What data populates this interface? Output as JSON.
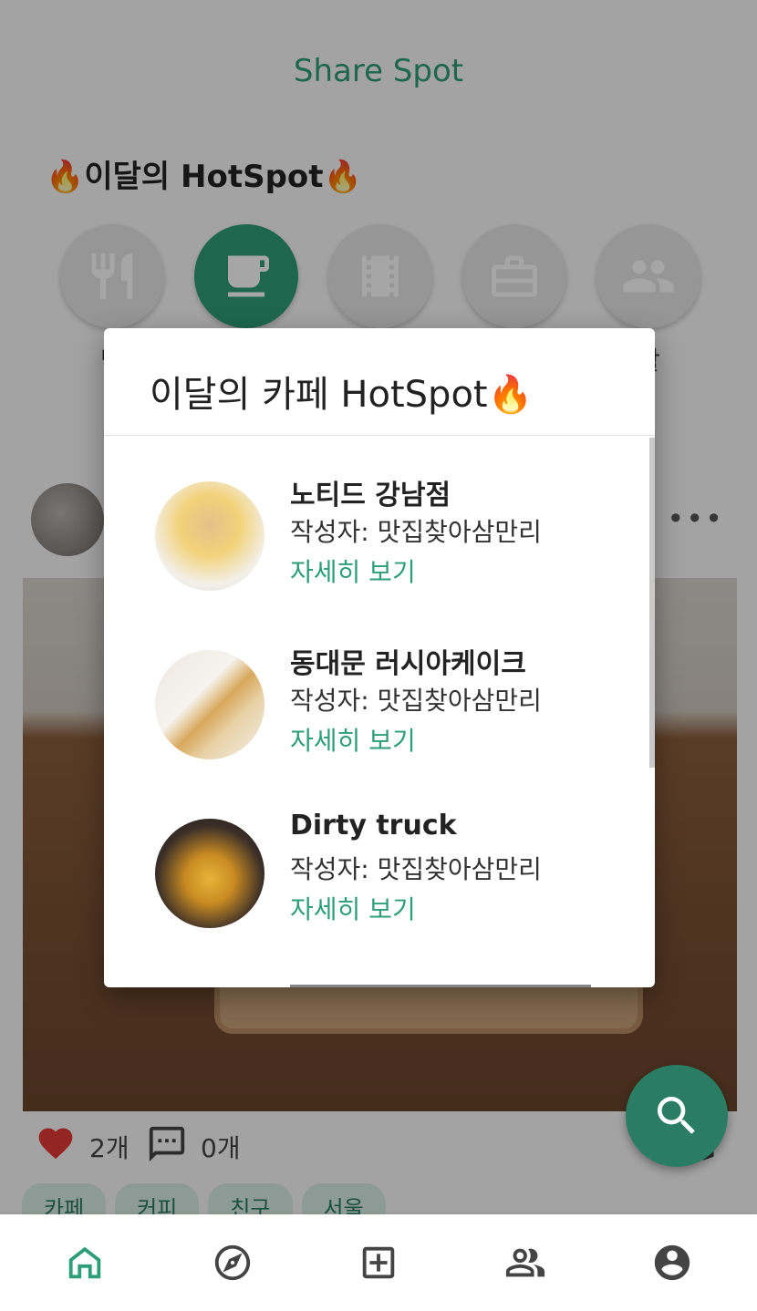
{
  "app": {
    "title": "Share Spot",
    "section_title": "🔥이달의 HotSpot🔥",
    "accent_color": "#2e9e78"
  },
  "categories": [
    {
      "icon": "fork-knife-icon",
      "label": "맛"
    },
    {
      "icon": "coffee-cup-icon",
      "label": "",
      "active": true
    },
    {
      "icon": "film-icon",
      "label": ""
    },
    {
      "icon": "briefcase-icon",
      "label": ""
    },
    {
      "icon": "people-icon",
      "label": "활"
    }
  ],
  "post": {
    "like_count": "2개",
    "comment_count": "0개",
    "more": "•••",
    "tags": [
      "카페",
      "커피",
      "친구",
      "서울"
    ]
  },
  "dialog": {
    "title": "이달의 카페 HotSpot🔥",
    "items": [
      {
        "name": "노티드 강남점",
        "author": "작성자: 맛집찾아삼만리",
        "detail": "자세히 보기"
      },
      {
        "name": "동대문 러시아케이크",
        "author": "작성자: 맛집찾아삼만리",
        "detail": "자세히 보기"
      },
      {
        "name": "Dirty truck",
        "author": "작성자: 맛집찾아삼만리",
        "detail": "자세히 보기"
      }
    ]
  },
  "bottom_nav": [
    "home-icon",
    "compass-icon",
    "add-box-icon",
    "friends-icon",
    "account-icon"
  ]
}
